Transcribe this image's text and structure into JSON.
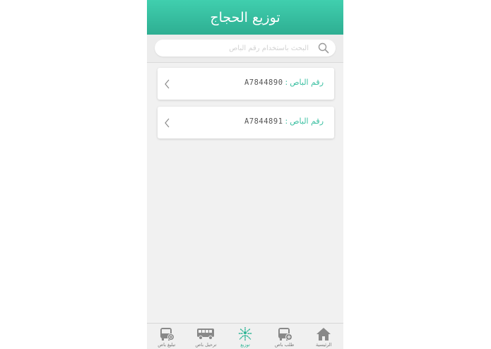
{
  "header": {
    "title": "توزيع الحجاج"
  },
  "search": {
    "placeholder": "البحث باستخدام رقم الباص",
    "icon": "search-icon"
  },
  "buses": [
    {
      "label": "رقم الباص",
      "separator": ":",
      "value": "A7844890"
    },
    {
      "label": "رقم الباص",
      "separator": ":",
      "value": "A7844891"
    }
  ],
  "tabs": [
    {
      "label": "الرئيسية",
      "icon": "home-icon",
      "active": false
    },
    {
      "label": "طلب باص",
      "icon": "bus-add-icon",
      "active": false
    },
    {
      "label": "توزيع",
      "icon": "distribute-icon",
      "active": true
    },
    {
      "label": "ترحيل باص",
      "icon": "bus-side-icon",
      "active": false
    },
    {
      "label": "تبليغ باص",
      "icon": "bus-report-icon",
      "active": false
    }
  ],
  "colors": {
    "accent": "#2fb596",
    "header": "#3cc0a2",
    "icon": "#888888"
  }
}
